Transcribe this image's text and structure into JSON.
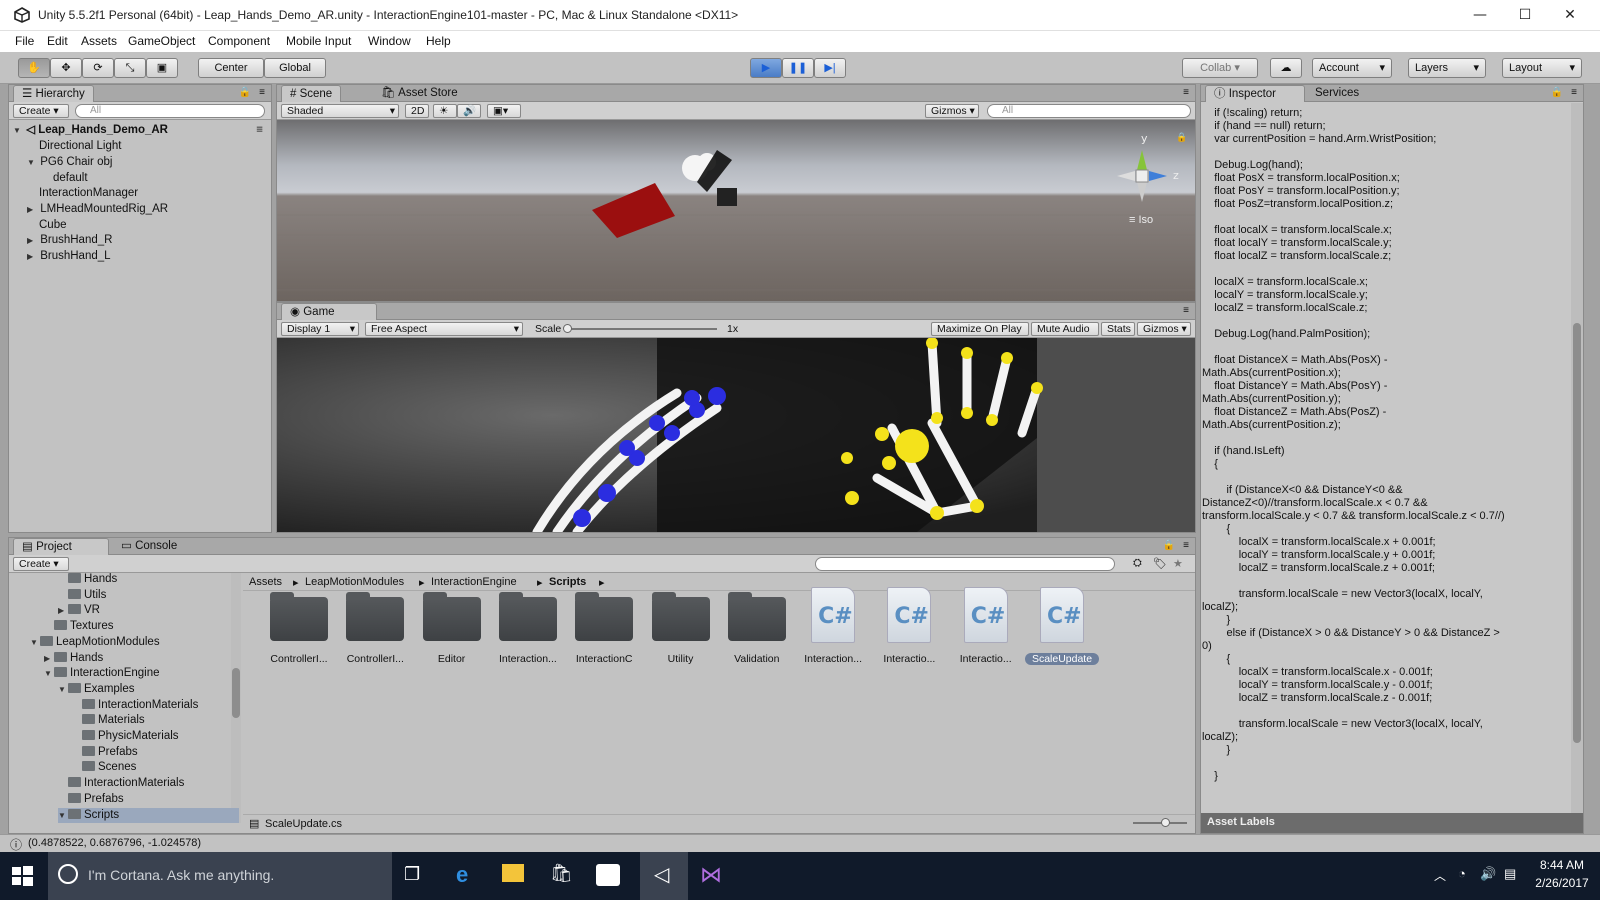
{
  "window": {
    "title": "Unity 5.5.2f1 Personal (64bit) - Leap_Hands_Demo_AR.unity - InteractionEngine101-master - PC, Mac & Linux Standalone <DX11>"
  },
  "menu": [
    "File",
    "Edit",
    "Assets",
    "GameObject",
    "Component",
    "Mobile Input",
    "Window",
    "Help"
  ],
  "toolbar": {
    "center": "Center",
    "global": "Global",
    "collab": "Collab",
    "account": "Account",
    "layers": "Layers",
    "layout": "Layout"
  },
  "hierarchy": {
    "tab": "Hierarchy",
    "create": "Create",
    "search": "All",
    "scene": "Leap_Hands_Demo_AR",
    "items": [
      "Directional Light",
      "PG6 Chair obj",
      "default",
      "InteractionManager",
      "LMHeadMountedRig_AR",
      "Cube",
      "BrushHand_R",
      "BrushHand_L"
    ]
  },
  "scene": {
    "tab": "Scene",
    "tab2": "Asset Store",
    "shaded": "Shaded",
    "mode2d": "2D",
    "gizmos": "Gizmos",
    "search": "All",
    "iso": "Iso",
    "axis_y": "y",
    "axis_z": "z"
  },
  "game": {
    "tab": "Game",
    "display": "Display 1",
    "aspect": "Free Aspect",
    "scale_label": "Scale",
    "scale_value": "1x",
    "max": "Maximize On Play",
    "mute": "Mute Audio",
    "stats": "Stats",
    "gizmos": "Gizmos"
  },
  "inspector": {
    "tab": "Inspector",
    "tab2": "Services",
    "asset_labels": "Asset Labels"
  },
  "code": [
    "    if (!scaling) return;",
    "    if (hand == null) return;",
    "    var currentPosition = hand.Arm.WristPosition;",
    "",
    "    Debug.Log(hand);",
    "    float PosX = transform.localPosition.x;",
    "    float PosY = transform.localPosition.y;",
    "    float PosZ=transform.localPosition.z;",
    "",
    "    float localX = transform.localScale.x;",
    "    float localY = transform.localScale.y;",
    "    float localZ = transform.localScale.z;",
    "",
    "    localX = transform.localScale.x;",
    "    localY = transform.localScale.y;",
    "    localZ = transform.localScale.z;",
    "",
    "    Debug.Log(hand.PalmPosition);",
    "",
    "    float DistanceX = Math.Abs(PosX) -",
    "Math.Abs(currentPosition.x);",
    "    float DistanceY = Math.Abs(PosY) -",
    "Math.Abs(currentPosition.y);",
    "    float DistanceZ = Math.Abs(PosZ) -",
    "Math.Abs(currentPosition.z);",
    "",
    "    if (hand.IsLeft)",
    "    {",
    "",
    "        if (DistanceX<0 && DistanceY<0 &&",
    "DistanceZ<0)//transform.localScale.x < 0.7 &&",
    "transform.localScale.y < 0.7 && transform.localScale.z < 0.7//)",
    "        {",
    "            localX = transform.localScale.x + 0.001f;",
    "            localY = transform.localScale.y + 0.001f;",
    "            localZ = transform.localScale.z + 0.001f;",
    "",
    "            transform.localScale = new Vector3(localX, localY,",
    "localZ);",
    "        }",
    "        else if (DistanceX > 0 && DistanceY > 0 && DistanceZ >",
    "0)",
    "        {",
    "            localX = transform.localScale.x - 0.001f;",
    "            localY = transform.localScale.y - 0.001f;",
    "            localZ = transform.localScale.z - 0.001f;",
    "",
    "            transform.localScale = new Vector3(localX, localY,",
    "localZ);",
    "        }",
    "",
    "    }"
  ],
  "project": {
    "tab": "Project",
    "tab2": "Console",
    "create": "Create",
    "tree": [
      {
        "label": "Hands",
        "indent": 3,
        "arrow": ""
      },
      {
        "label": "Utils",
        "indent": 3,
        "arrow": ""
      },
      {
        "label": "VR",
        "indent": 3,
        "arrow": "▶"
      },
      {
        "label": "Textures",
        "indent": 2,
        "arrow": ""
      },
      {
        "label": "LeapMotionModules",
        "indent": 1,
        "arrow": "▼"
      },
      {
        "label": "Hands",
        "indent": 2,
        "arrow": "▶"
      },
      {
        "label": "InteractionEngine",
        "indent": 2,
        "arrow": "▼"
      },
      {
        "label": "Examples",
        "indent": 3,
        "arrow": "▼"
      },
      {
        "label": "InteractionMaterials",
        "indent": 4,
        "arrow": ""
      },
      {
        "label": "Materials",
        "indent": 4,
        "arrow": ""
      },
      {
        "label": "PhysicMaterials",
        "indent": 4,
        "arrow": ""
      },
      {
        "label": "Prefabs",
        "indent": 4,
        "arrow": ""
      },
      {
        "label": "Scenes",
        "indent": 4,
        "arrow": ""
      },
      {
        "label": "InteractionMaterials",
        "indent": 3,
        "arrow": ""
      },
      {
        "label": "Prefabs",
        "indent": 3,
        "arrow": ""
      },
      {
        "label": "Scripts",
        "indent": 3,
        "arrow": "▼"
      }
    ],
    "breadcrumb": [
      "Assets",
      "LeapMotionModules",
      "InteractionEngine",
      "Scripts"
    ],
    "assets": [
      {
        "label": "ControllerI...",
        "kind": "folder"
      },
      {
        "label": "ControllerI...",
        "kind": "folder"
      },
      {
        "label": "Editor",
        "kind": "folder"
      },
      {
        "label": "Interaction...",
        "kind": "folder"
      },
      {
        "label": "InteractionC",
        "kind": "folder"
      },
      {
        "label": "Utility",
        "kind": "folder"
      },
      {
        "label": "Validation",
        "kind": "folder"
      },
      {
        "label": "Interaction...",
        "kind": "cs"
      },
      {
        "label": "Interactio...",
        "kind": "cs"
      },
      {
        "label": "Interactio...",
        "kind": "cs"
      },
      {
        "label": "ScaleUpdate",
        "kind": "cs"
      }
    ],
    "selected_file": "ScaleUpdate.cs",
    "cs_glyph": "C#"
  },
  "status": {
    "text": "(0.4878522, 0.6876796, -1.024578)"
  },
  "taskbar": {
    "cortana": "I'm Cortana. Ask me anything.",
    "time": "8:44 AM",
    "date": "2/26/2017"
  }
}
